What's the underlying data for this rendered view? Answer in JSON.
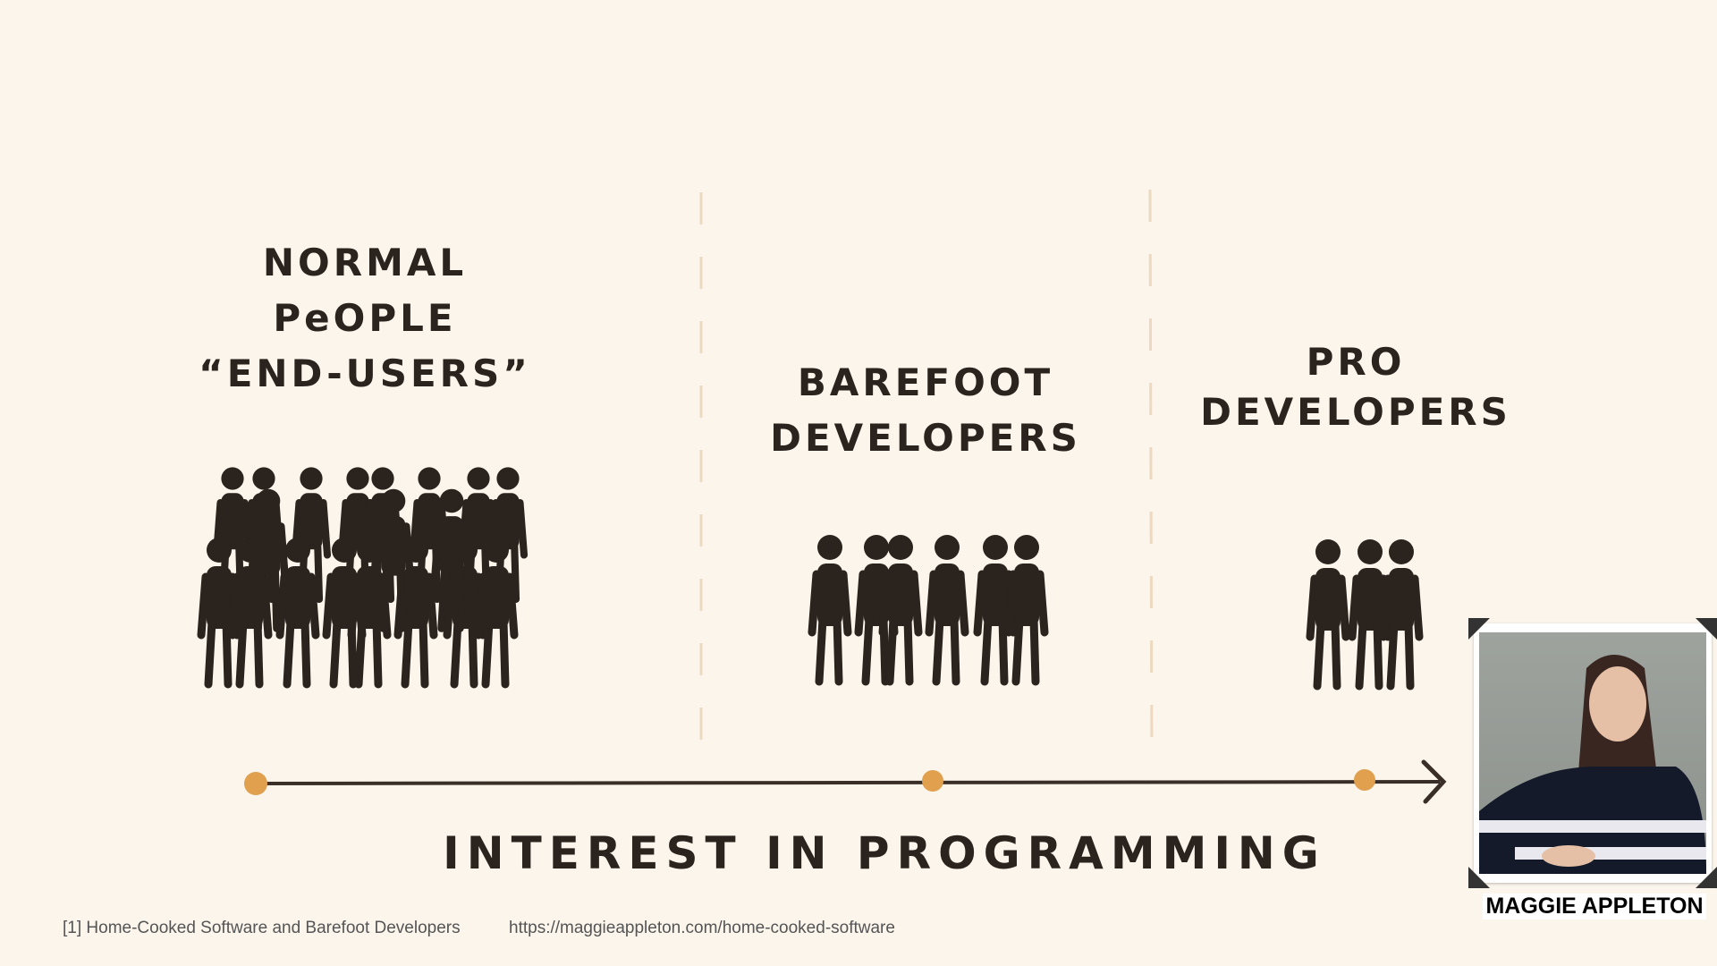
{
  "groups": [
    {
      "lines": [
        "NORMAL",
        "PeOPLE",
        "“END-USERS”"
      ],
      "count": 20
    },
    {
      "lines": [
        "BAREFOOT",
        "DEVELOPERS"
      ],
      "count": 7
    },
    {
      "lines": [
        "PRO",
        "DEVELOPERS"
      ],
      "count": 3
    }
  ],
  "axis_label": "INTEREST IN PROGRAMMING",
  "footer": {
    "citation": "[1] Home-Cooked Software and Barefoot Developers",
    "url": "https://maggieappleton.com/home-cooked-software"
  },
  "speaker": {
    "name": "MAGGIE APPLETON"
  },
  "colors": {
    "background": "#fbf5ec",
    "ink": "#2b231e",
    "accent": "#e0a04e",
    "divider": "#ecd9bf"
  }
}
